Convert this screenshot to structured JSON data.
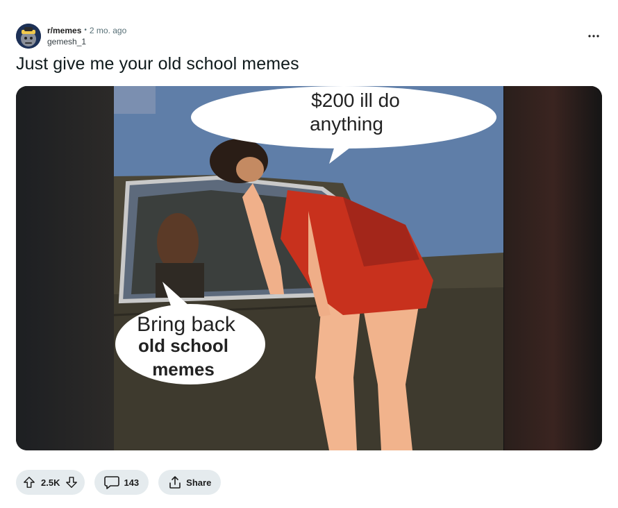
{
  "post": {
    "subreddit": "r/memes",
    "separator": "•",
    "time": "2 mo. ago",
    "author": "gemesh_1",
    "title": "Just give me your old school memes"
  },
  "meme": {
    "top_bubble_line1": "$200 ill do",
    "top_bubble_line2": "anything",
    "bottom_bubble_line1": "Bring back",
    "bottom_bubble_line2": "old school",
    "bottom_bubble_line3": "memes"
  },
  "actions": {
    "upvotes": "2.5K",
    "comments": "143",
    "share_label": "Share"
  },
  "icons": {
    "upvote": "arrow-up-outline-icon",
    "downvote": "arrow-down-outline-icon",
    "comment": "speech-bubble-icon",
    "share": "share-upload-icon",
    "overflow": "ellipsis-icon"
  }
}
